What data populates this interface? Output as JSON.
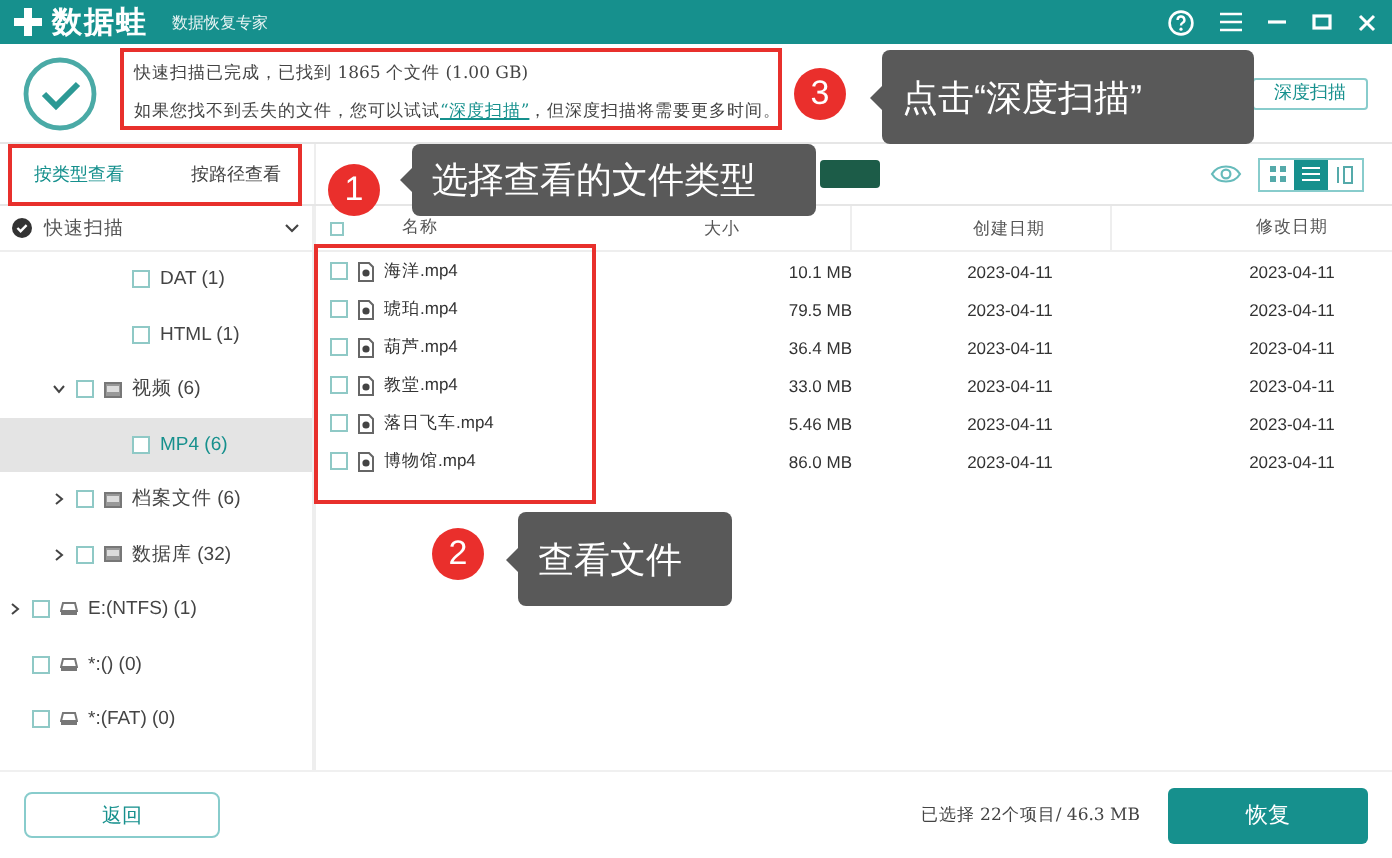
{
  "window": {
    "logo": "数据蛙",
    "subtitle": "数据恢复专家"
  },
  "scan_summary": {
    "status": "快速扫描已完成，已找到 1865 个文件 (1.00 GB)",
    "hint_before": "如果您找不到丢失的文件，您可以试试",
    "hint_link": "“深度扫描”",
    "hint_after": "，但深度扫描将需要更多时间。"
  },
  "deep_scan_button": "深度扫描",
  "view_tabs": [
    {
      "label": "按类型查看",
      "selected": true
    },
    {
      "label": "按路径查看",
      "selected": false
    }
  ],
  "scan_group": {
    "label": "快速扫描",
    "expanded": true
  },
  "tree": [
    {
      "children": [
        {
          "children": [
            {
              "label": "DAT (1)",
              "checked": false,
              "selected": false
            },
            {
              "label": "HTML (1)",
              "checked": false,
              "selected": false
            }
          ]
        },
        {
          "label": "视频 (6)",
          "checked": false,
          "selected": false,
          "expanded": true,
          "children": [
            {
              "label": "MP4 (6)",
              "checked": false,
              "selected": true
            }
          ]
        },
        {
          "label": "档案文件 (6)",
          "checked": false,
          "selected": false,
          "expanded": false
        },
        {
          "label": "数据库 (32)",
          "checked": false,
          "selected": false,
          "expanded": false
        }
      ]
    },
    {
      "label": "E:(NTFS) (1)",
      "checked": false,
      "selected": false,
      "expanded": false
    },
    {
      "label": "*:() (0)",
      "checked": false,
      "selected": false
    },
    {
      "label": "*:(FAT) (0)",
      "checked": false,
      "selected": false
    }
  ],
  "table": {
    "columns": [
      "名称",
      "大小",
      "创建日期",
      "修改日期"
    ],
    "all_checked": false,
    "rows": [
      {
        "name": "海洋.mp4",
        "size": "10.1 MB",
        "created": "2023-04-11",
        "modified": "2023-04-11",
        "checked": false
      },
      {
        "name": "琥珀.mp4",
        "size": "79.5 MB",
        "created": "2023-04-11",
        "modified": "2023-04-11",
        "checked": false
      },
      {
        "name": "葫芦.mp4",
        "size": "36.4 MB",
        "created": "2023-04-11",
        "modified": "2023-04-11",
        "checked": false
      },
      {
        "name": "教堂.mp4",
        "size": "33.0 MB",
        "created": "2023-04-11",
        "modified": "2023-04-11",
        "checked": false
      },
      {
        "name": "落日飞车.mp4",
        "size": "5.46 MB",
        "created": "2023-04-11",
        "modified": "2023-04-11",
        "checked": false
      },
      {
        "name": "博物馆.mp4",
        "size": "86.0 MB",
        "created": "2023-04-11",
        "modified": "2023-04-11",
        "checked": false
      }
    ]
  },
  "footer": {
    "back_button": "返回",
    "selection": "已选择 22个项目/ 46.3 MB",
    "recover_button": "恢复"
  },
  "annotations": [
    {
      "number": "3",
      "text": "点击“深度扫描”"
    },
    {
      "number": "1",
      "text": "选择查看的文件类型"
    },
    {
      "number": "2",
      "text": "查看文件"
    }
  ]
}
